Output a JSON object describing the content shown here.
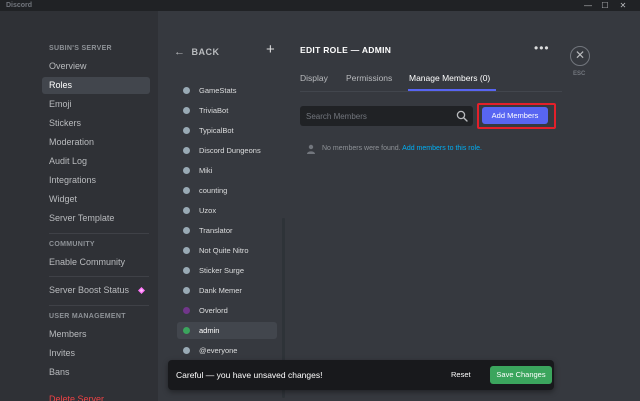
{
  "window": {
    "app_name": "Discord",
    "minimize": "—",
    "maximize": "☐",
    "close": "✕"
  },
  "sidebar": {
    "server_header": "SUBIN'S SERVER",
    "server_items": [
      {
        "label": "Overview"
      },
      {
        "label": "Roles",
        "active": true
      },
      {
        "label": "Emoji"
      },
      {
        "label": "Stickers"
      },
      {
        "label": "Moderation"
      },
      {
        "label": "Audit Log"
      },
      {
        "label": "Integrations"
      },
      {
        "label": "Widget"
      },
      {
        "label": "Server Template"
      }
    ],
    "community_header": "COMMUNITY",
    "community_item": "Enable Community",
    "boost_item": "Server Boost Status",
    "user_mgmt_header": "USER MANAGEMENT",
    "user_items": [
      {
        "label": "Members"
      },
      {
        "label": "Invites"
      },
      {
        "label": "Bans"
      }
    ],
    "delete_item": "Delete Server"
  },
  "roles_panel": {
    "back_label": "BACK",
    "plus_label": "+",
    "roles": [
      {
        "name": "GameStats",
        "color": "#99aab5"
      },
      {
        "name": "TriviaBot",
        "color": "#99aab5"
      },
      {
        "name": "TypicalBot",
        "color": "#99aab5"
      },
      {
        "name": "Discord Dungeons",
        "color": "#99aab5"
      },
      {
        "name": "Miki",
        "color": "#99aab5"
      },
      {
        "name": "counting",
        "color": "#99aab5"
      },
      {
        "name": "Uzox",
        "color": "#99aab5"
      },
      {
        "name": "Translator",
        "color": "#99aab5"
      },
      {
        "name": "Not Quite Nitro",
        "color": "#99aab5"
      },
      {
        "name": "Sticker Surge",
        "color": "#99aab5"
      },
      {
        "name": "Dank Memer",
        "color": "#99aab5"
      },
      {
        "name": "Overlord",
        "color": "#71368a"
      },
      {
        "name": "admin",
        "color": "#3ba55d",
        "selected": true
      },
      {
        "name": "@everyone",
        "color": "#99aab5"
      }
    ]
  },
  "edit_role": {
    "title": "EDIT ROLE — ADMIN",
    "more_label": "•••",
    "esc_icon": "✕",
    "esc_label": "ESC",
    "tabs": [
      {
        "label": "Display"
      },
      {
        "label": "Permissions"
      },
      {
        "label": "Manage Members (0)",
        "active": true
      }
    ],
    "search_placeholder": "Search Members",
    "add_members_label": "Add Members",
    "no_members_text": "No members were found.",
    "add_members_link": "Add members to this role."
  },
  "unsaved_bar": {
    "message": "Careful — you have unsaved changes!",
    "reset_label": "Reset",
    "save_label": "Save Changes"
  },
  "colors": {
    "accent": "#5865f2",
    "save_green": "#3ba55d",
    "highlight_red": "#e4202a",
    "link_blue": "#00aff4",
    "boost_pink": "#ff73fa"
  }
}
